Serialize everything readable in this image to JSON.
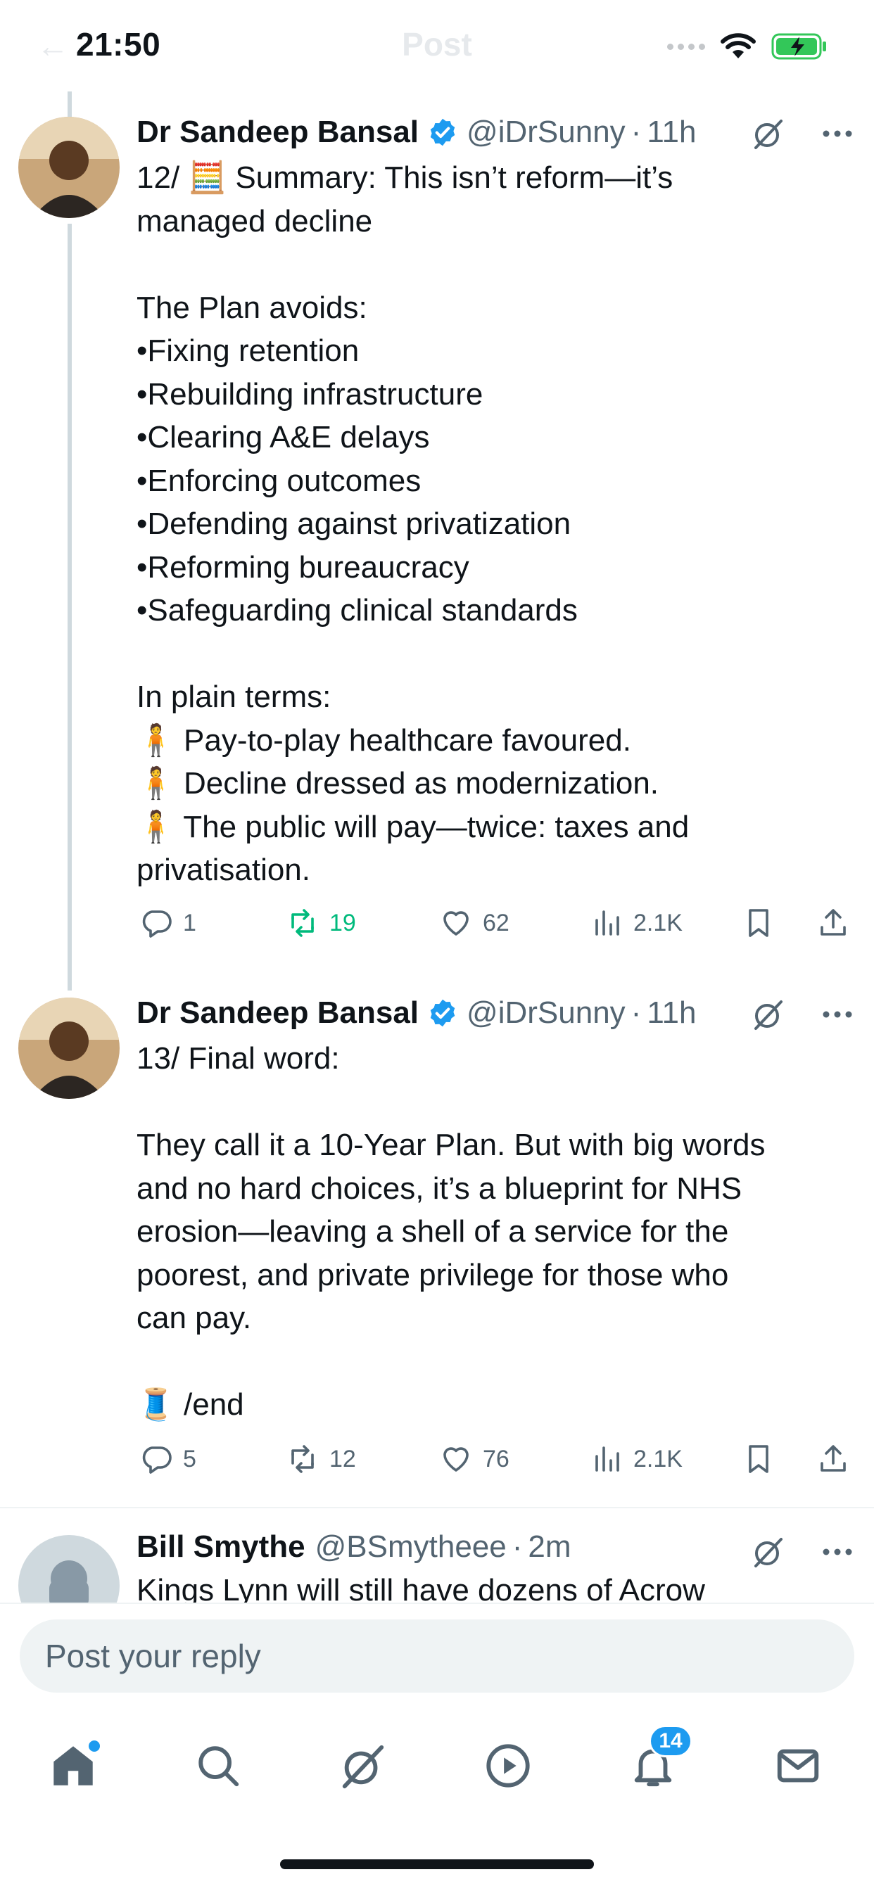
{
  "status_bar": {
    "time": "21:50"
  },
  "header": {
    "title": "Post"
  },
  "tweets": [
    {
      "name": "Dr Sandeep Bansal",
      "handle": "@iDrSunny",
      "time": "11h",
      "lines": [
        "12/ 🧮 Summary: This isn’t reform—it’s",
        "managed decline",
        "",
        "The Plan avoids:",
        "•Fixing retention",
        "•Rebuilding infrastructure",
        "•Clearing A&E delays",
        "•Enforcing outcomes",
        "•Defending against privatization",
        "•Reforming bureaucracy",
        "•Safeguarding clinical standards",
        "",
        "In plain terms:",
        "🧍 Pay-to-play healthcare favoured.",
        "🧍 Decline dressed as modernization.",
        "🧍 The public will pay—twice: taxes and",
        "privatisation."
      ],
      "replies": "1",
      "reposts": "19",
      "likes": "62",
      "views": "2.1K"
    },
    {
      "name": "Dr Sandeep Bansal",
      "handle": "@iDrSunny",
      "time": "11h",
      "lines": [
        "13/ Final word:",
        "",
        "They call it a 10-Year Plan. But with big words",
        "and no hard choices, it’s a blueprint for NHS",
        "erosion—leaving a shell of a service for the",
        "poorest, and private privilege for those who",
        "can pay.",
        "",
        "🧵 /end"
      ],
      "replies": "5",
      "reposts": "12",
      "likes": "76",
      "views": "2.1K"
    },
    {
      "name": "Bill Smythe",
      "handle": "@BSmytheee",
      "time": "2m",
      "lines": [
        "Kings Lynn will still have dozens of Acrow"
      ]
    }
  ],
  "reply": {
    "placeholder": "Post your reply"
  },
  "tabbar": {
    "notifications_badge": "14"
  },
  "colors": {
    "accent": "#1d9bf0",
    "repost_active": "#00ba7c",
    "muted": "#536471"
  }
}
